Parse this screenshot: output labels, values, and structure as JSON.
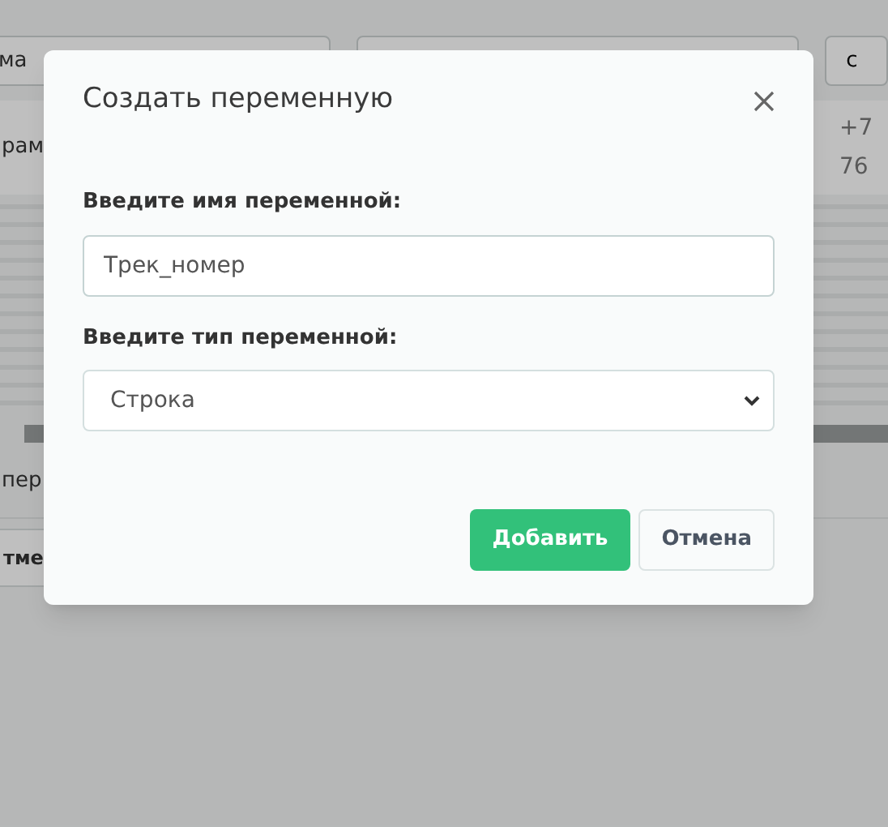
{
  "background": {
    "filter_field": {
      "value": "ма"
    },
    "button": "с",
    "row": {
      "cell_1": "рам",
      "cell_2": [
        "+7",
        "76"
      ]
    },
    "note": "пер",
    "button_2": "тме"
  },
  "dialog": {
    "title": "Создать переменную",
    "fields": [
      {
        "kind": "text",
        "label": "Введите имя переменной:",
        "value": "Трек_номер"
      },
      {
        "kind": "select",
        "label": "Введите тип переменной:",
        "value": "Строка"
      }
    ],
    "buttons": [
      {
        "kind": "primary",
        "label": "Добавить"
      },
      {
        "kind": "secondary",
        "label": "Отмена"
      }
    ]
  }
}
